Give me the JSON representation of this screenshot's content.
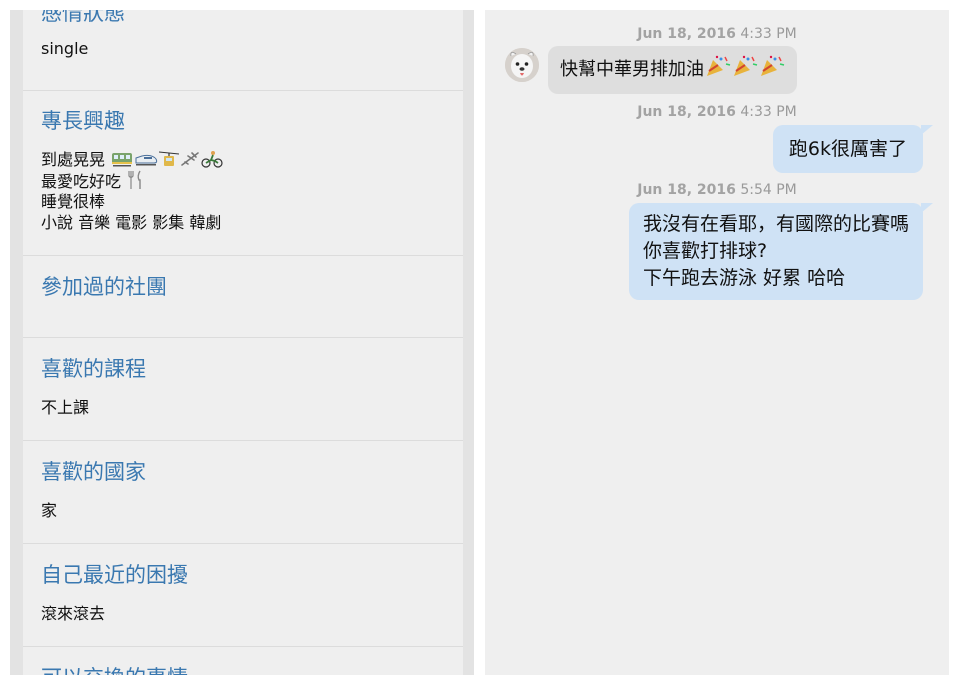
{
  "profile": {
    "sections": [
      {
        "title": "感情狀態",
        "lines": [
          "single"
        ]
      },
      {
        "title": "專長興趣",
        "lines": [
          "到處晃晃",
          "最愛吃好吃",
          "睡覺很棒",
          "小說 音樂 電影 影集 韓劇"
        ]
      },
      {
        "title": "參加過的社團",
        "lines": []
      },
      {
        "title": "喜歡的課程",
        "lines": [
          "不上課"
        ]
      },
      {
        "title": "喜歡的國家",
        "lines": [
          "家"
        ]
      },
      {
        "title": "自己最近的困擾",
        "lines": [
          "滾來滾去"
        ]
      },
      {
        "title": "可以交換的事情",
        "lines": []
      }
    ],
    "emoji_icons": [
      "tram-icon",
      "bullet-train-icon",
      "aerial-tramway-icon",
      "airplane-icon",
      "bicyclist-icon",
      "fork-and-knife-icon"
    ]
  },
  "chat": {
    "messages": [
      {
        "date": "Jun 18, 2016",
        "time": "4:33 PM",
        "direction": "incoming",
        "text": "快幫中華男排加油",
        "emoji": [
          "party-popper-icon",
          "party-popper-icon",
          "party-popper-icon"
        ]
      },
      {
        "date": "Jun 18, 2016",
        "time": "4:33 PM",
        "direction": "outgoing",
        "lines": [
          "跑6k很厲害了"
        ]
      },
      {
        "date": "Jun 18, 2016",
        "time": "5:54 PM",
        "direction": "outgoing",
        "lines": [
          "我沒有在看耶，有國際的比賽嗎",
          "你喜歡打排球?",
          "下午跑去游泳 好累 哈哈"
        ]
      }
    ]
  },
  "colors": {
    "section_title": "#3a78b0",
    "incoming_bubble": "#dedede",
    "outgoing_bubble": "#cfe2f5",
    "timestamp": "#9a9a9a"
  }
}
